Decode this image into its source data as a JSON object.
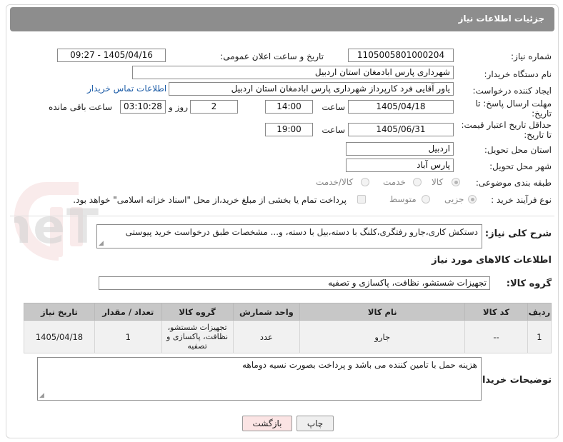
{
  "header": {
    "title": "جزئیات اطلاعات نیاز"
  },
  "form": {
    "need_number_label": "شماره نیاز:",
    "need_number": "1105005801000204",
    "announce_label": "تاریخ و ساعت اعلان عمومی:",
    "announce_value": "1405/04/16 - 09:27",
    "buyer_org_label": "نام دستگاه خریدار:",
    "buyer_org": "شهرداری پارس ابادمغان استان اردبیل",
    "requester_label": "ایجاد کننده درخواست:",
    "requester": "یاور آقایی فرد کارپرداز شهرداری پارس ابادمغان استان اردبیل",
    "contact_link": "اطلاعات تماس خریدار",
    "deadline_label_1": "مهلت ارسال پاسخ: تا",
    "deadline_label_2": "تاریخ:",
    "deadline_date": "1405/04/18",
    "time_label": "ساعت",
    "deadline_time": "14:00",
    "days_value": "2",
    "days_label": "روز و",
    "remaining_value": "03:10:28",
    "remaining_label": "ساعت باقی مانده",
    "validity_label_1": "حداقل تاریخ اعتبار قیمت:",
    "validity_label_2": "تا تاریخ:",
    "validity_date": "1405/06/31",
    "validity_time": "19:00",
    "province_label": "استان محل تحویل:",
    "province": "اردبیل",
    "city_label": "شهر محل تحویل:",
    "city": "پارس آباد",
    "category_label": "طبقه بندی موضوعی:",
    "category_options": [
      "کالا",
      "خدمت",
      "کالا/خدمت"
    ],
    "process_label": "نوع فرآیند خرید :",
    "process_options": [
      "جزیی",
      "متوسط"
    ],
    "payment_note": "پرداخت تمام یا بخشی از مبلغ خرید،از محل \"اسناد خزانه اسلامی\" خواهد بود."
  },
  "description": {
    "label": "شرح کلی نیاز:",
    "text": "دستکش کاری،جارو رفتگری،کلنگ با دسته،بیل با دسته، و... مشخصات طبق درخواست خرید پیوستی"
  },
  "goods": {
    "section_title": "اطلاعات کالاهای مورد نیاز",
    "group_label": "گروه کالا:",
    "group_value": "تجهیزات شستشو، نظافت، پاکسازی و تصفیه",
    "columns": [
      "ردیف",
      "کد کالا",
      "نام کالا",
      "واحد شمارش",
      "گروه کالا",
      "تعداد / مقدار",
      "تاریخ نیاز"
    ],
    "rows": [
      [
        "1",
        "--",
        "جارو",
        "عدد",
        "تجهیزات شستشو، نظافت، پاکسازی و تصفیه",
        "1",
        "1405/04/18"
      ]
    ]
  },
  "buyer_notes": {
    "label": "توضیحات خریدار:",
    "text": "هزینه حمل با تامین کننده می باشد و پرداخت بصورت نسیه دوماهه"
  },
  "buttons": {
    "print": "چاپ",
    "back": "بازگشت"
  },
  "watermark": {
    "text": "AriaTender.neT"
  },
  "colors": {
    "header_bg": "#8d8d8d",
    "table_header": "#c7c7c7",
    "link": "#1f5ea8",
    "back_button_bg": "#fbe4e4"
  }
}
